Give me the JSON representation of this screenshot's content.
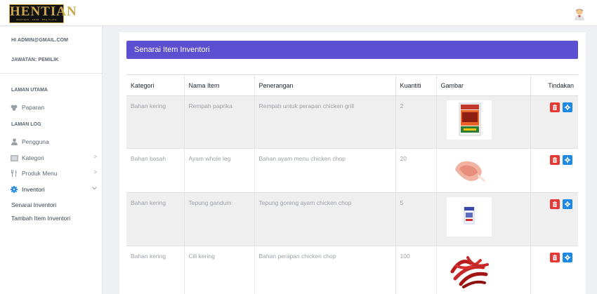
{
  "brand": {
    "logo_text": "HENTIAN",
    "logo_subtext": "WESTERN · ARAB · BBQ PLATE"
  },
  "header": {
    "avatar_icon": "user-avatar-icon"
  },
  "sidebar": {
    "greeting": "HI ADMIN@GMAIL.COM",
    "role": "JAWATAN: PEMILIK",
    "sections": [
      {
        "title": "LAMAN UTAMA"
      },
      {
        "title": "LAMAN LOG"
      }
    ],
    "items": [
      {
        "label": "Paparan",
        "icon": "dashboard-icon"
      },
      {
        "label": "Pengguna",
        "icon": "user-icon"
      },
      {
        "label": "Kategori",
        "icon": "category-icon"
      },
      {
        "label": "Produk Menu",
        "icon": "cutlery-icon"
      },
      {
        "label": "Inventori",
        "icon": "gear-icon"
      }
    ],
    "submenu": [
      {
        "label": "Senarai Inventori"
      },
      {
        "label": "Tambah Item Inventori"
      }
    ]
  },
  "main": {
    "title": "Senarai Item Inventori",
    "columns": [
      "Kategori",
      "Nama Item",
      "Penerangan",
      "Kuantiti",
      "Gambar",
      "Tindakan"
    ],
    "rows": [
      {
        "kategori": "Bahan kering",
        "nama": "Rempah paprika",
        "penerangan": "Rempah untuk perapan chicken grill",
        "kuantiti": "2"
      },
      {
        "kategori": "Bahan basah",
        "nama": "Ayam whole leg",
        "penerangan": "Bahan ayam menu chicken chop",
        "kuantiti": "20"
      },
      {
        "kategori": "Bahan kering",
        "nama": "Tepung gandum",
        "penerangan": "Tepung goreng ayam chicken chop",
        "kuantiti": "5"
      },
      {
        "kategori": "Bahan kering",
        "nama": "Cili kering",
        "penerangan": "Bahan perapan chicken chop",
        "kuantiti": "100"
      }
    ]
  },
  "colors": {
    "header_bar": "#5c4fd1",
    "delete_button": "#e53935",
    "edit_button": "#1e88e5",
    "active_icon": "#1e88e5"
  }
}
